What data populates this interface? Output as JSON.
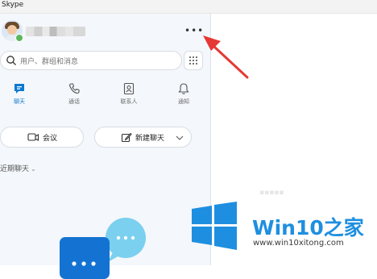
{
  "window": {
    "title": "Skype"
  },
  "profile": {
    "more_label": "•••"
  },
  "search": {
    "placeholder": "用户、群组和消息"
  },
  "tabs": [
    {
      "label": "聊天",
      "icon": "chat-icon",
      "active": true
    },
    {
      "label": "通话",
      "icon": "phone-icon",
      "active": false
    },
    {
      "label": "联系人",
      "icon": "contacts-icon",
      "active": false
    },
    {
      "label": "通知",
      "icon": "bell-icon",
      "active": false
    }
  ],
  "actions": {
    "meeting_label": "会议",
    "new_chat_label": "新建聊天"
  },
  "recent": {
    "label": "近期聊天"
  },
  "watermark": {
    "brand": "Win10",
    "brand_suffix": "之家",
    "url": "www.win10xitong.com"
  },
  "colors": {
    "accent": "#0b79d0",
    "arrow": "#e53935",
    "brand_blue": "#1e8fe0",
    "presence": "#5bb75b"
  }
}
